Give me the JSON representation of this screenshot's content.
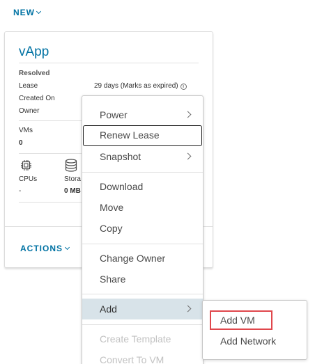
{
  "toolbar": {
    "new_label": "NEW"
  },
  "card": {
    "title": "vApp",
    "status": "Resolved",
    "lease_label": "Lease",
    "lease_value": "29 days (Marks as expired)",
    "created_on_label": "Created On",
    "owner_label": "Owner",
    "vms_label": "VMs",
    "vms_value": "0",
    "cpus_label": "CPUs",
    "cpus_value": "-",
    "storage_label": "Stora",
    "storage_value": "0 MB",
    "actions_label": "ACTIONS"
  },
  "menu": {
    "items": [
      {
        "label": "Power"
      },
      {
        "label": "Renew Lease"
      },
      {
        "label": "Snapshot"
      },
      {
        "label": "Download"
      },
      {
        "label": "Move"
      },
      {
        "label": "Copy"
      },
      {
        "label": "Change Owner"
      },
      {
        "label": "Share"
      },
      {
        "label": "Add"
      },
      {
        "label": "Create Template"
      },
      {
        "label": "Convert To VM"
      }
    ]
  },
  "submenu": {
    "items": [
      {
        "label": "Add VM"
      },
      {
        "label": "Add Network"
      }
    ]
  },
  "colors": {
    "accent": "#0072a3",
    "highlight": "#e0474c",
    "active_bg": "#d8e3e9"
  }
}
